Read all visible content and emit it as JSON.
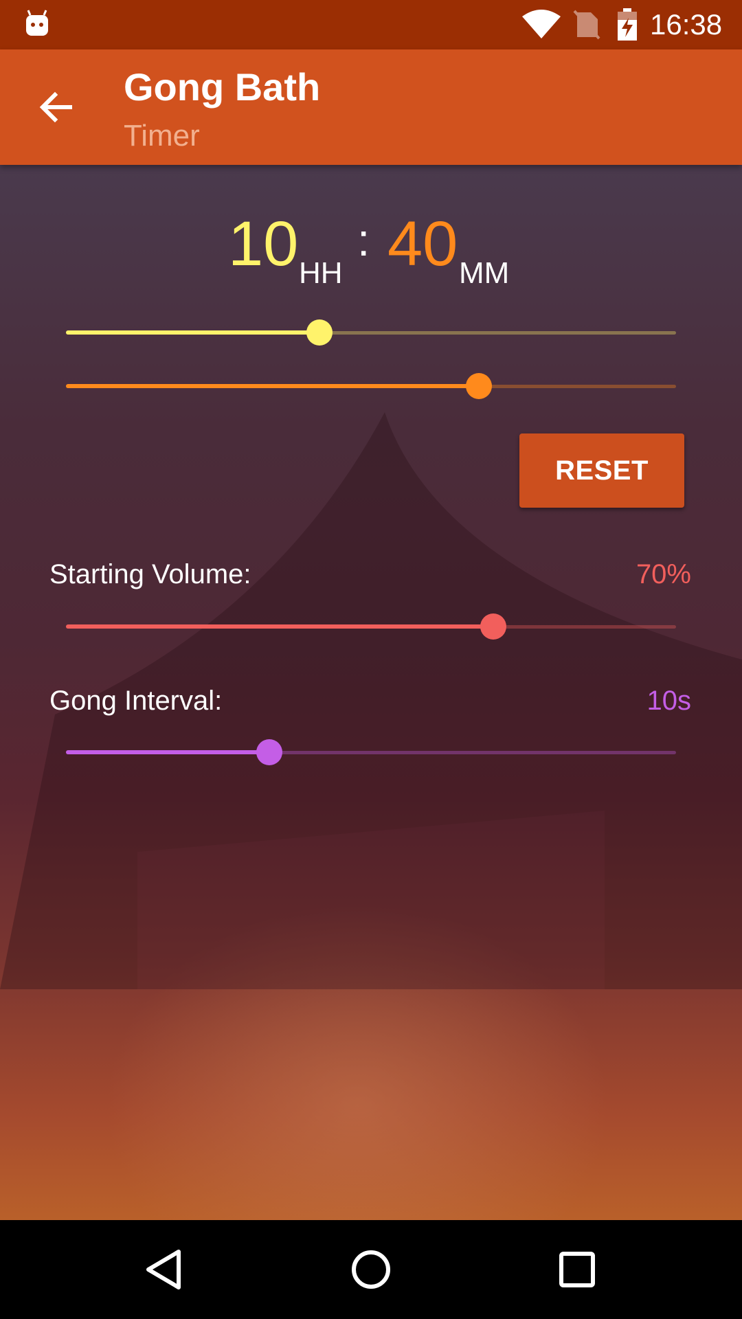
{
  "status_bar": {
    "time": "16:38",
    "icons": [
      "android-icon",
      "wifi-icon",
      "no-sim-icon",
      "battery-charging-icon"
    ]
  },
  "app_bar": {
    "title": "Gong Bath",
    "subtitle": "Timer",
    "back_icon": "arrow-back-icon"
  },
  "timer": {
    "hours": "10",
    "hours_unit": "HH",
    "separator": ":",
    "minutes": "40",
    "minutes_unit": "MM",
    "hours_slider_fraction": 0.416,
    "minutes_slider_fraction": 0.677
  },
  "reset_label": "RESET",
  "settings": {
    "starting_volume": {
      "label": "Starting Volume:",
      "value": "70%",
      "slider_fraction": 0.7
    },
    "gong_interval": {
      "label": "Gong Interval:",
      "value": "10s",
      "slider_fraction": 0.333
    }
  },
  "colors": {
    "status_bar": "#9b2e03",
    "app_bar": "#d1521e",
    "hours": "#fff36b",
    "minutes": "#ff8a1c",
    "volume": "#f25f5c",
    "interval": "#c45ee6",
    "reset_button": "#cc4f1e"
  },
  "nav_bar": {
    "icons": [
      "back-triangle-icon",
      "home-circle-icon",
      "recents-square-icon"
    ]
  }
}
